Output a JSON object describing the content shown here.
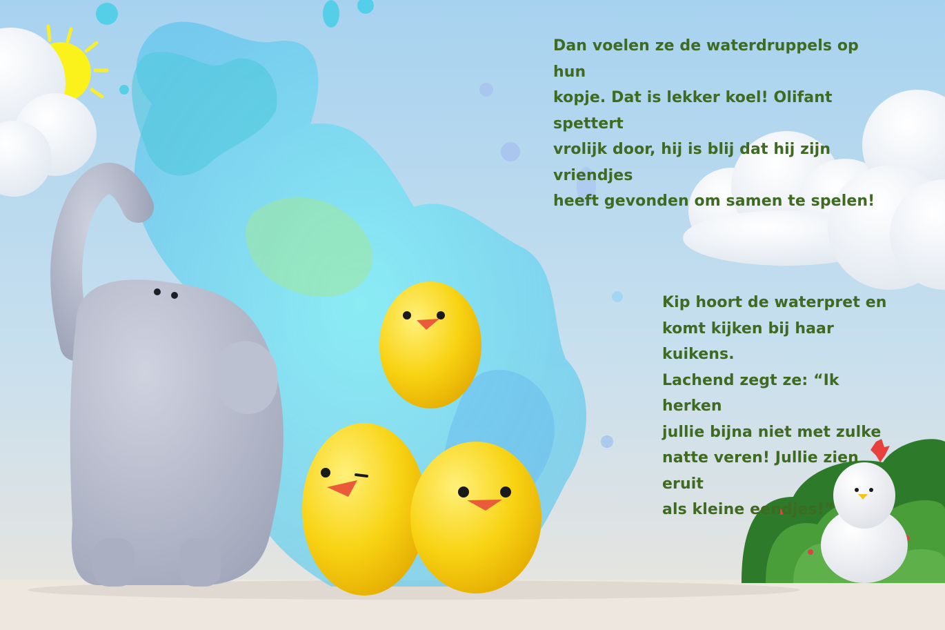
{
  "story": {
    "paragraph_top": "Dan voelen ze de waterdruppels op hun\nkopje. Dat is lekker koel! Olifant spettert\nvrolijk door, hij is blij dat hij zijn vriendjes\nheeft gevonden om samen te spelen!",
    "paragraph_right": "Kip hoort de waterpret en\nkomt kijken bij haar kuikens.\nLachend zegt ze: “Ik herken\njullie bijna niet met zulke\nnatte veren! Jullie zien eruit\nals kleine eendjes!”"
  },
  "colors": {
    "sky_top": "#a9d3ef",
    "sky_bottom": "#e9e4dd",
    "text": "#3f6a22",
    "chick": "#f7cf12",
    "water": "#5fd8e8",
    "elephant": "#b3b8c9"
  },
  "characters": [
    "elephant",
    "chick",
    "chick",
    "chick",
    "hen",
    "sun",
    "cloud",
    "bush"
  ]
}
